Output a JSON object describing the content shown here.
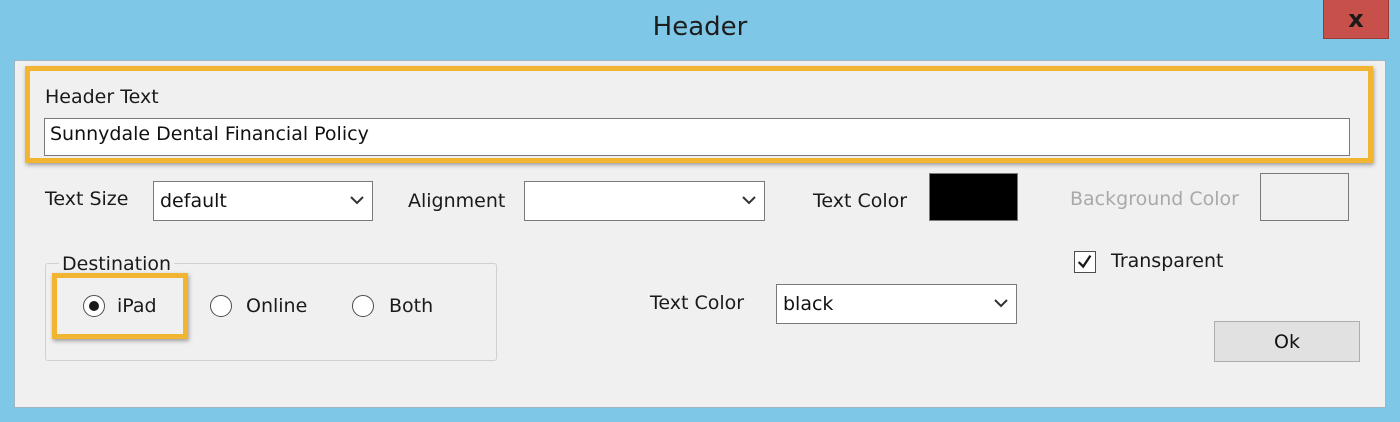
{
  "window": {
    "title": "Header",
    "close_label": "x"
  },
  "header_text": {
    "label": "Header Text",
    "value": "Sunnydale Dental Financial Policy"
  },
  "text_size": {
    "label": "Text Size",
    "value": "default"
  },
  "alignment": {
    "label": "Alignment",
    "value": ""
  },
  "text_color_swatch": {
    "label": "Text Color",
    "color": "#000000"
  },
  "background_color": {
    "label": "Background Color",
    "color": "#f0f0f0"
  },
  "destination": {
    "label": "Destination",
    "options": [
      {
        "label": "iPad",
        "selected": true
      },
      {
        "label": "Online",
        "selected": false
      },
      {
        "label": "Both",
        "selected": false
      }
    ]
  },
  "text_color_select": {
    "label": "Text Color",
    "value": "black"
  },
  "transparent": {
    "label": "Transparent",
    "checked": true
  },
  "ok_button": {
    "label": "Ok"
  },
  "colors": {
    "highlight": "#f2b531",
    "titlebar": "#7fc7e6",
    "close": "#c7504a"
  }
}
